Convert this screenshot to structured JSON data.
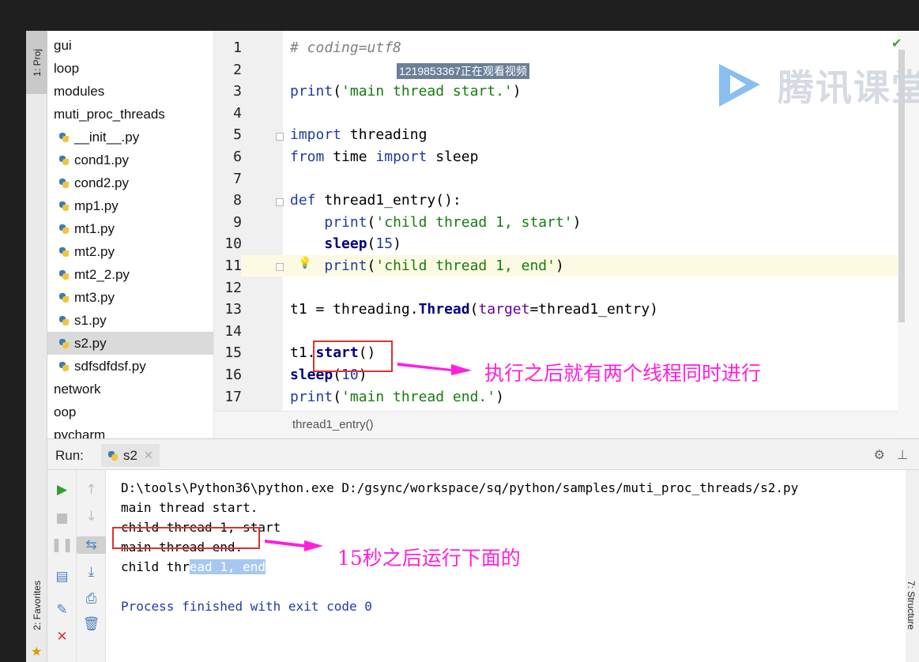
{
  "tool_windows": {
    "project_tab": "1: Proj",
    "favorites_tab": "2: Favorites",
    "structure_tab": "7: Structure"
  },
  "project_tree": [
    {
      "label": "gui",
      "type": "folder"
    },
    {
      "label": "loop",
      "type": "folder"
    },
    {
      "label": "modules",
      "type": "folder"
    },
    {
      "label": "muti_proc_threads",
      "type": "folder"
    },
    {
      "label": "__init__.py",
      "type": "file"
    },
    {
      "label": "cond1.py",
      "type": "file"
    },
    {
      "label": "cond2.py",
      "type": "file"
    },
    {
      "label": "mp1.py",
      "type": "file"
    },
    {
      "label": "mt1.py",
      "type": "file"
    },
    {
      "label": "mt2.py",
      "type": "file"
    },
    {
      "label": "mt2_2.py",
      "type": "file"
    },
    {
      "label": "mt3.py",
      "type": "file"
    },
    {
      "label": "s1.py",
      "type": "file"
    },
    {
      "label": "s2.py",
      "type": "file",
      "selected": true
    },
    {
      "label": "sdfsdfdsf.py",
      "type": "file"
    },
    {
      "label": "network",
      "type": "folder"
    },
    {
      "label": "oop",
      "type": "folder"
    },
    {
      "label": "pycharm",
      "type": "folder"
    }
  ],
  "editor": {
    "current_line": 11,
    "lines": [
      {
        "n": "1",
        "code": "# coding=utf8"
      },
      {
        "n": "2",
        "code": ""
      },
      {
        "n": "3",
        "code": "print('main thread start.')"
      },
      {
        "n": "4",
        "code": ""
      },
      {
        "n": "5",
        "code": "import threading"
      },
      {
        "n": "6",
        "code": "from time import sleep"
      },
      {
        "n": "7",
        "code": ""
      },
      {
        "n": "8",
        "code": "def thread1_entry():"
      },
      {
        "n": "9",
        "code": "    print('child thread 1, start')"
      },
      {
        "n": "10",
        "code": "    sleep(15)"
      },
      {
        "n": "11",
        "code": "    print('child thread 1, end')"
      },
      {
        "n": "12",
        "code": ""
      },
      {
        "n": "13",
        "code": "t1 = threading.Thread(target=thread1_entry)"
      },
      {
        "n": "14",
        "code": ""
      },
      {
        "n": "15",
        "code": "t1.start()"
      },
      {
        "n": "16",
        "code": "sleep(10)"
      },
      {
        "n": "17",
        "code": "print('main thread end.')"
      }
    ],
    "breadcrumb": "thread1_entry()"
  },
  "watermark": {
    "viewer_text": "1219853367正在观看视频",
    "brand": "腾讯课堂"
  },
  "annotations": {
    "start_note": "执行之后就有两个线程同时进行",
    "end_note": "15秒之后运行下面的",
    "color": "#ff1fdc",
    "box_color": "#e03030"
  },
  "run": {
    "label": "Run:",
    "tab_name": "s2",
    "output": {
      "cmd": "D:\\tools\\Python36\\python.exe D:/gsync/workspace/sq/python/samples/muti_proc_threads/s2.py",
      "l1": "main thread start.",
      "l2": "child thread 1, start",
      "l3": "main thread end.",
      "l4_plain": "child thr",
      "l4_selected": "ead 1, end",
      "l5": "Process finished with exit code 0"
    }
  }
}
